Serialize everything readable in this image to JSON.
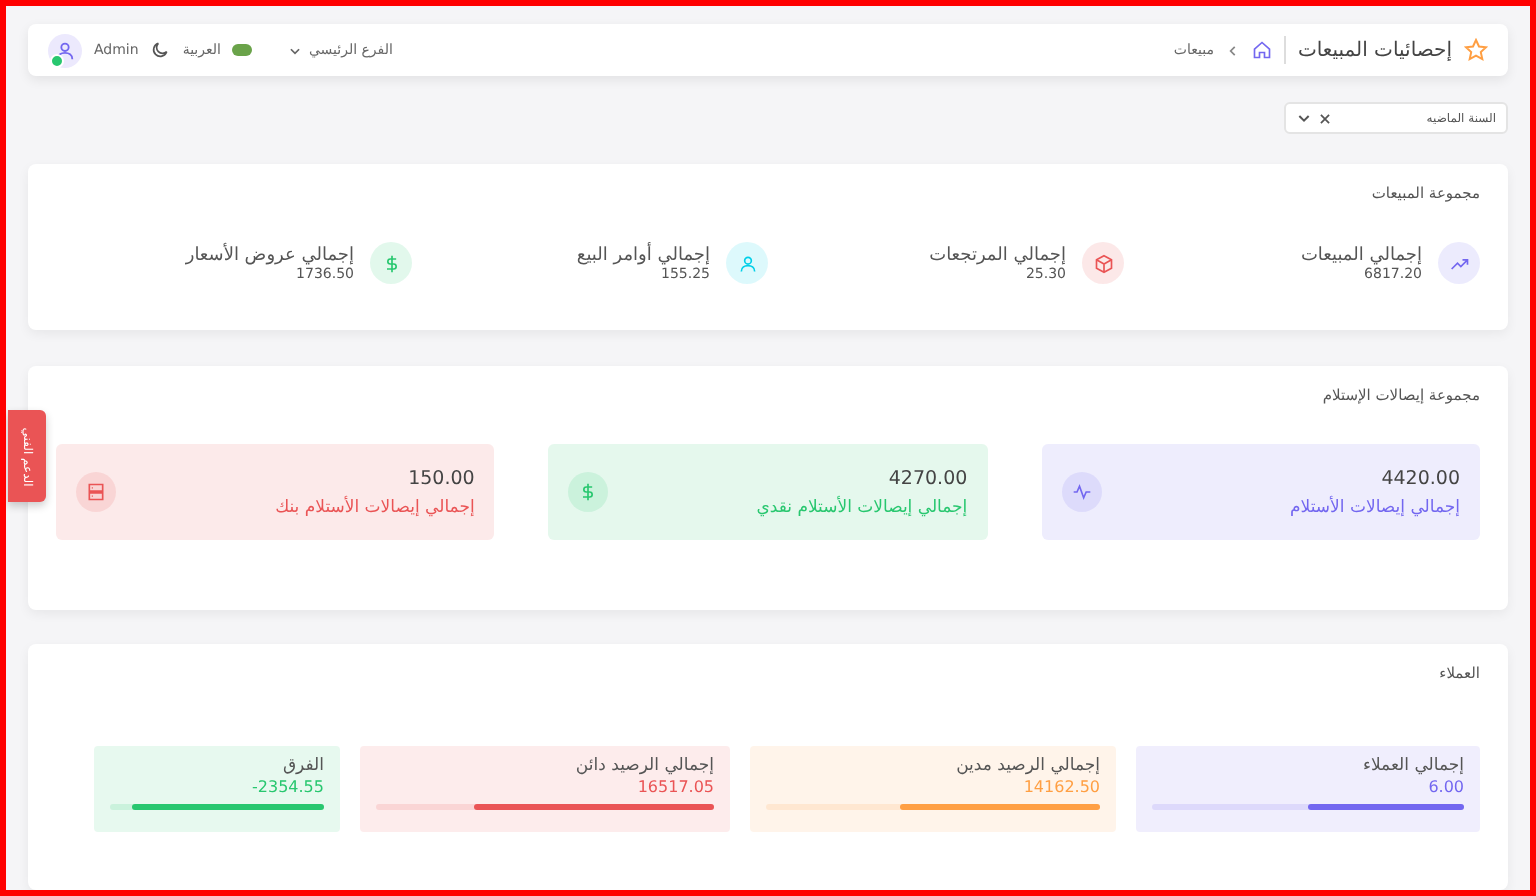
{
  "header": {
    "title": "إحصائيات المبيعات",
    "breadcrumb": "مبيعات",
    "branch": "الفرع الرئيسي",
    "language": "العربية",
    "user": "Admin"
  },
  "filter": {
    "value": "السنة الماضيه"
  },
  "sales_group": {
    "title": "مجموعة المبيعات",
    "items": [
      {
        "label": "إجمالي المبيعات",
        "value": "6817.20",
        "kind": "trend",
        "color": "#7367f0"
      },
      {
        "label": "إجمالي المرتجعات",
        "value": "25.30",
        "kind": "box",
        "color": "#ea5455"
      },
      {
        "label": "إجمالي أوامر البيع",
        "value": "155.25",
        "kind": "user",
        "color": "#00cfe8"
      },
      {
        "label": "إجمالي عروض الأسعار",
        "value": "1736.50",
        "kind": "dollar",
        "color": "#28c76f"
      }
    ]
  },
  "receipts_group": {
    "title": "مجموعة إيصالات الإستلام",
    "items": [
      {
        "label": "إجمالي إيصالات الأستلام",
        "value": "4420.00",
        "kind": "pulse",
        "color": "#7367f0"
      },
      {
        "label": "إجمالي إيصالات الأستلام نقدي",
        "value": "4270.00",
        "kind": "dollar",
        "color": "#28c76f"
      },
      {
        "label": "إجمالي إيصالات الأستلام بنك",
        "value": "150.00",
        "kind": "server",
        "color": "#ea5455"
      }
    ]
  },
  "customers_group": {
    "title": "العملاء",
    "items": [
      {
        "label": "إجمالي العملاء",
        "value": "6.00",
        "level": 0.5,
        "color": "#7367f0"
      },
      {
        "label": "إجمالي الرصيد مدين",
        "value": "14162.50",
        "level": 0.6,
        "color": "#ff9f43"
      },
      {
        "label": "إجمالي الرصيد دائن",
        "value": "16517.05",
        "level": 0.71,
        "color": "#ea5455"
      },
      {
        "label": "الفرق",
        "value": "2354.55-",
        "level": 0.9,
        "color": "#28c76f"
      }
    ]
  },
  "support_tab": {
    "label": "الدعم الفني"
  }
}
